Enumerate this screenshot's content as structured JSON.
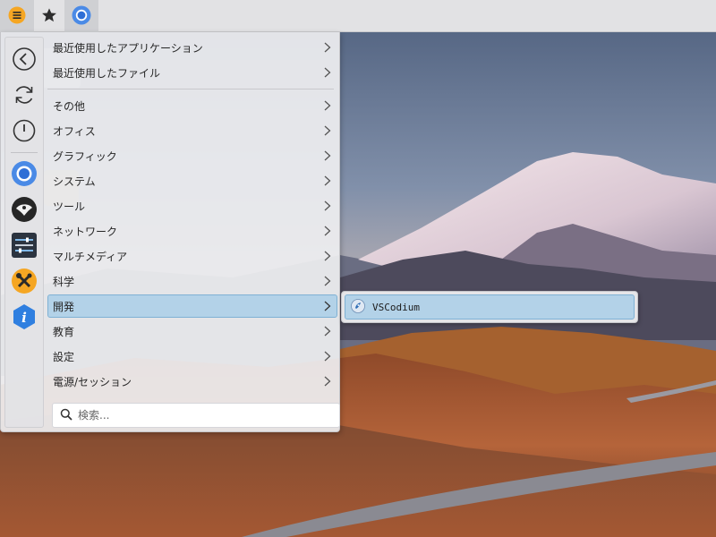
{
  "taskbar": {
    "buttons": [
      {
        "icon": "app-menu-icon",
        "active": true
      },
      {
        "icon": "star-icon",
        "active": false
      },
      {
        "icon": "chromium-icon",
        "active": true
      }
    ]
  },
  "favorites": [
    {
      "icon": "back-arrow-icon"
    },
    {
      "icon": "refresh-icon"
    },
    {
      "icon": "power-icon"
    },
    {
      "icon": "chromium-icon"
    },
    {
      "icon": "snowflake-icon"
    },
    {
      "icon": "settings-panel-icon"
    },
    {
      "icon": "wrench-tools-icon"
    },
    {
      "icon": "info-icon"
    }
  ],
  "menu": {
    "recent": [
      {
        "label": "最近使用したアプリケーション"
      },
      {
        "label": "最近使用したファイル"
      }
    ],
    "categories": [
      {
        "label": "その他"
      },
      {
        "label": "オフィス"
      },
      {
        "label": "グラフィック"
      },
      {
        "label": "システム"
      },
      {
        "label": "ツール"
      },
      {
        "label": "ネットワーク"
      },
      {
        "label": "マルチメディア"
      },
      {
        "label": "科学"
      },
      {
        "label": "開発",
        "selected": true
      },
      {
        "label": "教育"
      },
      {
        "label": "設定"
      },
      {
        "label": "電源/セッション"
      }
    ]
  },
  "search": {
    "placeholder": "検索..."
  },
  "submenu": {
    "items": [
      {
        "label": "VSCodium",
        "icon": "vscodium-icon"
      }
    ]
  },
  "colors": {
    "selection": "#b3d2e8",
    "selection_border": "#7fb1d4",
    "accent_orange": "#f5a623"
  }
}
